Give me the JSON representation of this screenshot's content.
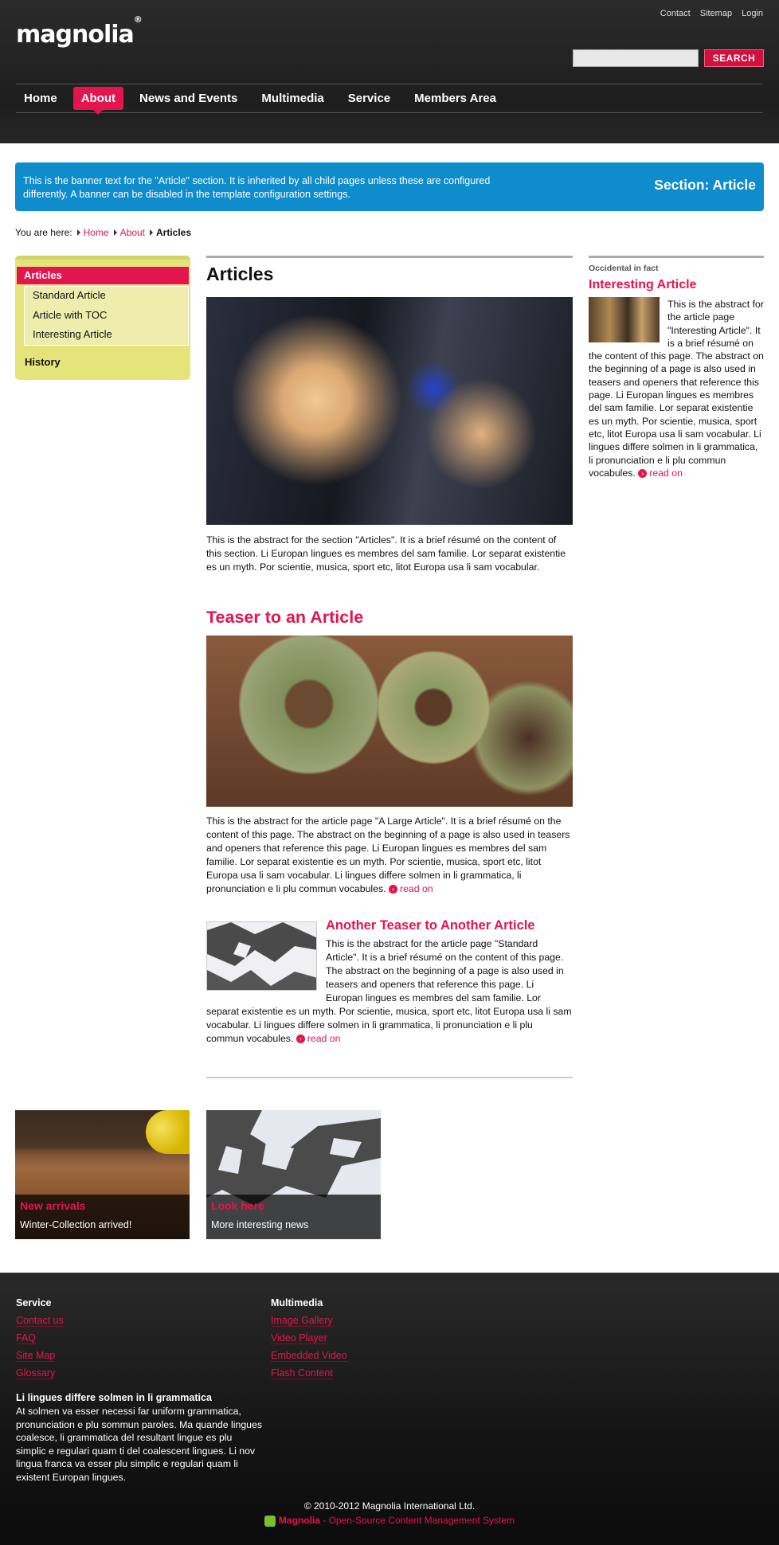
{
  "header": {
    "logo_text": "magnolia",
    "logo_mark": "®",
    "meta_nav": [
      "Contact",
      "Sitemap",
      "Login"
    ],
    "search_button": "SEARCH",
    "search_value": ""
  },
  "main_nav": [
    {
      "label": "Home",
      "active": false
    },
    {
      "label": "About",
      "active": true
    },
    {
      "label": "News and Events",
      "active": false
    },
    {
      "label": "Multimedia",
      "active": false
    },
    {
      "label": "Service",
      "active": false
    },
    {
      "label": "Members Area",
      "active": false
    }
  ],
  "banner": {
    "text": "This is the banner text for the \"Article\" section. It is inherited by all child pages unless these are configured differently. A banner can be disabled in the template configuration settings.",
    "title": "Section: Article"
  },
  "breadcrumb": {
    "prefix": "You are here:",
    "items": [
      "Home",
      "About"
    ],
    "current": "Articles"
  },
  "subnav": {
    "active": "Articles",
    "children": [
      "Standard Article",
      "Article with TOC",
      "Interesting Article"
    ],
    "sibling": "History"
  },
  "main": {
    "title": "Articles",
    "intro": "This is the abstract for the section \"Articles\". It is a brief résumé on the content of this section. Li Europan lingues es membres del sam familie. Lor separat existentie es un myth. Por scientie, musica, sport etc, litot Europa usa li sam vocabular.",
    "teaser1": {
      "title": "Teaser to an Article",
      "text": "This is the abstract for the article page \"A Large Article\". It is a brief résumé on the content of this page. The abstract on the beginning of a page is also used in teasers and openers that reference this page. Li Europan lingues es membres del sam familie. Lor separat existentie es un myth. Por scientie, musica, sport etc, litot Europa usa li sam vocabular. Li lingues differe solmen in li grammatica, li pronunciation e li plu commun vocabules.",
      "read_on": "read on"
    },
    "teaser2": {
      "title": "Another Teaser to Another Article",
      "text": "This is the abstract for the article page \"Standard Article\". It is a brief résumé on the content of this page. The abstract on the beginning of a page is also used in teasers and openers that reference this page. Li Europan lingues es membres del sam familie. Lor separat existentie es un myth. Por scientie, musica, sport etc, litot Europa usa li sam vocabular. Li lingues differe solmen in li grammatica, li pronunciation e li plu commun vocabules.",
      "read_on": "read on"
    }
  },
  "sidebar": {
    "kicker": "Occidental in fact",
    "title": "Interesting Article",
    "text": "This is the abstract for the article page \"Interesting Article\". It is a brief résumé on the content of this page. The abstract on the beginning of a page is also used in teasers and openers that reference this page. Li Europan lingues es membres del sam familie. Lor separat existentie es un myth. Por scientie, musica, sport etc, litot Europa usa li sam vocabular. Li lingues differe solmen in li grammatica, li pronunciation e li plu commun vocabules.",
    "read_on": "read on"
  },
  "promos": [
    {
      "title": "New arrivals",
      "subtitle": "Winter-Collection arrived!"
    },
    {
      "title": "Look here",
      "subtitle": "More interesting news"
    }
  ],
  "footer": {
    "col1_title": "Service",
    "col1_links": [
      "Contact us",
      "FAQ",
      "Site Map",
      "Glossary"
    ],
    "col2_title": "Multimedia",
    "col2_links": [
      "Image Gallery",
      "Video Player",
      "Embedded Video",
      "Flash Content"
    ],
    "heading": "Li lingues differe solmen in li grammatica",
    "text": "At solmen va esser necessi far uniform grammatica, pronunciation e plu sommun paroles. Ma quande lingues coalesce, li grammatica del resultant lingue es plu simplic e regulari quam ti del coalescent lingues. Li nov lingua franca va esser plu simplic e regulari quam li existent Europan lingues.",
    "copyright": "© 2010-2012 Magnolia International Ltd.",
    "powered_brand": "Magnolia",
    "powered_rest": " - Open-Source Content Management System"
  },
  "colors": {
    "accent": "#e3154f",
    "banner": "#0f8ccc",
    "subnav": "#e5e47b"
  }
}
